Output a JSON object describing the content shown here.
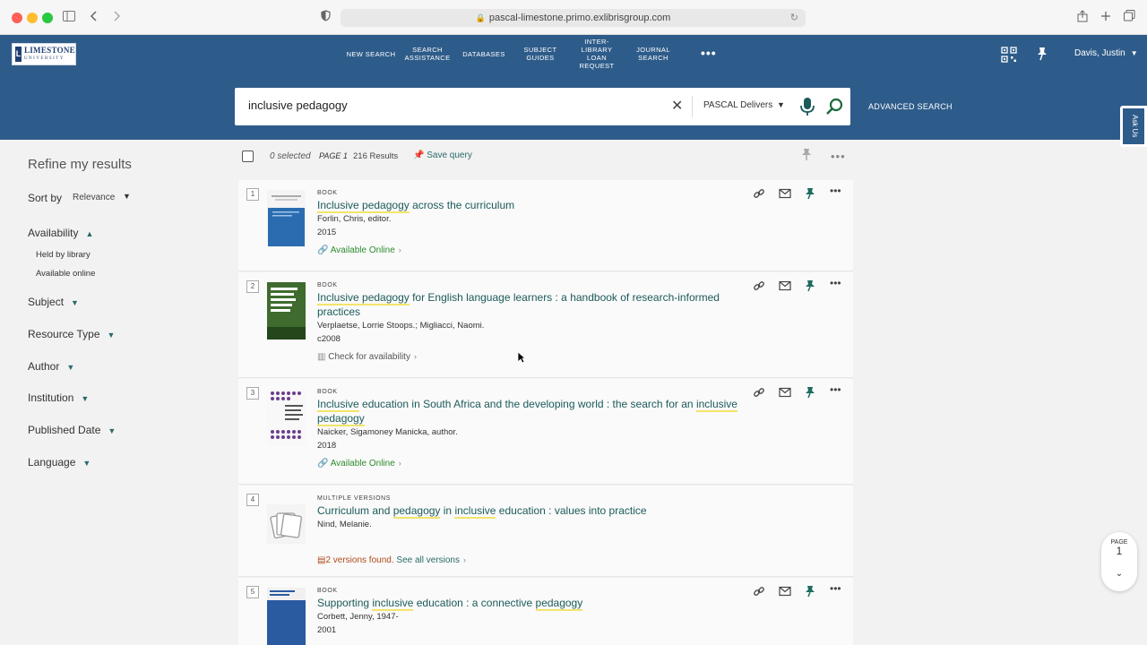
{
  "browser": {
    "url": "pascal-limestone.primo.exlibrisgroup.com"
  },
  "header": {
    "logo_text": "LIMESTONE",
    "logo_sub": "UNIVERSITY",
    "nav": [
      "NEW SEARCH",
      "SEARCH ASSISTANCE",
      "DATABASES",
      "SUBJECT GUIDES",
      "INTER-LIBRARY LOAN REQUEST",
      "JOURNAL SEARCH"
    ],
    "nav_more": "•••",
    "user": "Davis, Justin",
    "search_value": "inclusive pedagogy",
    "scope": "PASCAL Delivers",
    "advanced_search": "ADVANCED SEARCH",
    "ask_us": "Ask Us"
  },
  "sidebar": {
    "title": "Refine my results",
    "sort_label": "Sort by",
    "sort_value": "Relevance",
    "availability": "Availability",
    "availability_options": [
      "Held by library",
      "Available online"
    ],
    "facets": [
      "Subject",
      "Resource Type",
      "Author",
      "Institution",
      "Published Date",
      "Language"
    ]
  },
  "toolbar": {
    "selected": "0 selected",
    "page": "PAGE 1",
    "results": "216 Results",
    "save_query": "Save query"
  },
  "results": [
    {
      "num": "1",
      "type": "BOOK",
      "title_parts": [
        {
          "t": "Inclusive pedagogy",
          "hl": true
        },
        {
          "t": " across the curriculum",
          "hl": false
        }
      ],
      "author": "Forlin, Chris, editor.",
      "year": "2015",
      "avail": "Available Online"
    },
    {
      "num": "2",
      "type": "BOOK",
      "title_parts": [
        {
          "t": "Inclusive pedagogy",
          "hl": true
        },
        {
          "t": " for English language learners : a handbook of research-informed practices",
          "hl": false
        }
      ],
      "author": "Verplaetse, Lorrie Stoops.; Migliacci, Naomi.",
      "year": "c2008",
      "avail": "Check for availability"
    },
    {
      "num": "3",
      "type": "BOOK",
      "title_parts": [
        {
          "t": "Inclusive",
          "hl": true
        },
        {
          "t": " education in South Africa and the developing world : the search for an ",
          "hl": false
        },
        {
          "t": "inclusive pedagogy",
          "hl": true
        }
      ],
      "author": "Naicker, Sigamoney Manicka, author.",
      "year": "2018",
      "avail": "Available Online"
    },
    {
      "num": "4",
      "type": "MULTIPLE VERSIONS",
      "title_parts": [
        {
          "t": "Curriculum and ",
          "hl": false
        },
        {
          "t": "pedagogy",
          "hl": true
        },
        {
          "t": " in ",
          "hl": false
        },
        {
          "t": "inclusive",
          "hl": true
        },
        {
          "t": " education : values into practice",
          "hl": false
        }
      ],
      "author": "Nind, Melanie.",
      "year": "",
      "avail_versions": "2 versions found.",
      "avail_link": "See all versions"
    },
    {
      "num": "5",
      "type": "BOOK",
      "title_parts": [
        {
          "t": "Supporting ",
          "hl": false
        },
        {
          "t": "inclusive",
          "hl": true
        },
        {
          "t": " education : a connective ",
          "hl": false
        },
        {
          "t": "pedagogy",
          "hl": true
        }
      ],
      "author": "Corbett, Jenny, 1947-",
      "year": "2001"
    }
  ],
  "page_indicator": {
    "label": "PAGE",
    "num": "1"
  },
  "colors": {
    "header_bg": "#2e5c8a",
    "title_link": "#1c5a5a",
    "available": "#2e8b2e",
    "pin": "#1d6b5f"
  }
}
